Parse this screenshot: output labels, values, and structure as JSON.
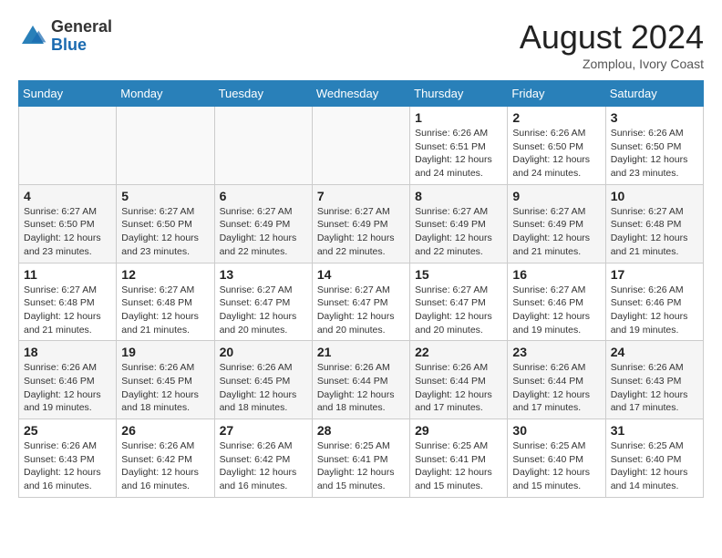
{
  "header": {
    "logo_line1": "General",
    "logo_line2": "Blue",
    "month_year": "August 2024",
    "location": "Zomplou, Ivory Coast"
  },
  "days_of_week": [
    "Sunday",
    "Monday",
    "Tuesday",
    "Wednesday",
    "Thursday",
    "Friday",
    "Saturday"
  ],
  "weeks": [
    [
      {
        "day": "",
        "info": ""
      },
      {
        "day": "",
        "info": ""
      },
      {
        "day": "",
        "info": ""
      },
      {
        "day": "",
        "info": ""
      },
      {
        "day": "1",
        "info": "Sunrise: 6:26 AM\nSunset: 6:51 PM\nDaylight: 12 hours\nand 24 minutes."
      },
      {
        "day": "2",
        "info": "Sunrise: 6:26 AM\nSunset: 6:50 PM\nDaylight: 12 hours\nand 24 minutes."
      },
      {
        "day": "3",
        "info": "Sunrise: 6:26 AM\nSunset: 6:50 PM\nDaylight: 12 hours\nand 23 minutes."
      }
    ],
    [
      {
        "day": "4",
        "info": "Sunrise: 6:27 AM\nSunset: 6:50 PM\nDaylight: 12 hours\nand 23 minutes."
      },
      {
        "day": "5",
        "info": "Sunrise: 6:27 AM\nSunset: 6:50 PM\nDaylight: 12 hours\nand 23 minutes."
      },
      {
        "day": "6",
        "info": "Sunrise: 6:27 AM\nSunset: 6:49 PM\nDaylight: 12 hours\nand 22 minutes."
      },
      {
        "day": "7",
        "info": "Sunrise: 6:27 AM\nSunset: 6:49 PM\nDaylight: 12 hours\nand 22 minutes."
      },
      {
        "day": "8",
        "info": "Sunrise: 6:27 AM\nSunset: 6:49 PM\nDaylight: 12 hours\nand 22 minutes."
      },
      {
        "day": "9",
        "info": "Sunrise: 6:27 AM\nSunset: 6:49 PM\nDaylight: 12 hours\nand 21 minutes."
      },
      {
        "day": "10",
        "info": "Sunrise: 6:27 AM\nSunset: 6:48 PM\nDaylight: 12 hours\nand 21 minutes."
      }
    ],
    [
      {
        "day": "11",
        "info": "Sunrise: 6:27 AM\nSunset: 6:48 PM\nDaylight: 12 hours\nand 21 minutes."
      },
      {
        "day": "12",
        "info": "Sunrise: 6:27 AM\nSunset: 6:48 PM\nDaylight: 12 hours\nand 21 minutes."
      },
      {
        "day": "13",
        "info": "Sunrise: 6:27 AM\nSunset: 6:47 PM\nDaylight: 12 hours\nand 20 minutes."
      },
      {
        "day": "14",
        "info": "Sunrise: 6:27 AM\nSunset: 6:47 PM\nDaylight: 12 hours\nand 20 minutes."
      },
      {
        "day": "15",
        "info": "Sunrise: 6:27 AM\nSunset: 6:47 PM\nDaylight: 12 hours\nand 20 minutes."
      },
      {
        "day": "16",
        "info": "Sunrise: 6:27 AM\nSunset: 6:46 PM\nDaylight: 12 hours\nand 19 minutes."
      },
      {
        "day": "17",
        "info": "Sunrise: 6:26 AM\nSunset: 6:46 PM\nDaylight: 12 hours\nand 19 minutes."
      }
    ],
    [
      {
        "day": "18",
        "info": "Sunrise: 6:26 AM\nSunset: 6:46 PM\nDaylight: 12 hours\nand 19 minutes."
      },
      {
        "day": "19",
        "info": "Sunrise: 6:26 AM\nSunset: 6:45 PM\nDaylight: 12 hours\nand 18 minutes."
      },
      {
        "day": "20",
        "info": "Sunrise: 6:26 AM\nSunset: 6:45 PM\nDaylight: 12 hours\nand 18 minutes."
      },
      {
        "day": "21",
        "info": "Sunrise: 6:26 AM\nSunset: 6:44 PM\nDaylight: 12 hours\nand 18 minutes."
      },
      {
        "day": "22",
        "info": "Sunrise: 6:26 AM\nSunset: 6:44 PM\nDaylight: 12 hours\nand 17 minutes."
      },
      {
        "day": "23",
        "info": "Sunrise: 6:26 AM\nSunset: 6:44 PM\nDaylight: 12 hours\nand 17 minutes."
      },
      {
        "day": "24",
        "info": "Sunrise: 6:26 AM\nSunset: 6:43 PM\nDaylight: 12 hours\nand 17 minutes."
      }
    ],
    [
      {
        "day": "25",
        "info": "Sunrise: 6:26 AM\nSunset: 6:43 PM\nDaylight: 12 hours\nand 16 minutes."
      },
      {
        "day": "26",
        "info": "Sunrise: 6:26 AM\nSunset: 6:42 PM\nDaylight: 12 hours\nand 16 minutes."
      },
      {
        "day": "27",
        "info": "Sunrise: 6:26 AM\nSunset: 6:42 PM\nDaylight: 12 hours\nand 16 minutes."
      },
      {
        "day": "28",
        "info": "Sunrise: 6:25 AM\nSunset: 6:41 PM\nDaylight: 12 hours\nand 15 minutes."
      },
      {
        "day": "29",
        "info": "Sunrise: 6:25 AM\nSunset: 6:41 PM\nDaylight: 12 hours\nand 15 minutes."
      },
      {
        "day": "30",
        "info": "Sunrise: 6:25 AM\nSunset: 6:40 PM\nDaylight: 12 hours\nand 15 minutes."
      },
      {
        "day": "31",
        "info": "Sunrise: 6:25 AM\nSunset: 6:40 PM\nDaylight: 12 hours\nand 14 minutes."
      }
    ]
  ]
}
